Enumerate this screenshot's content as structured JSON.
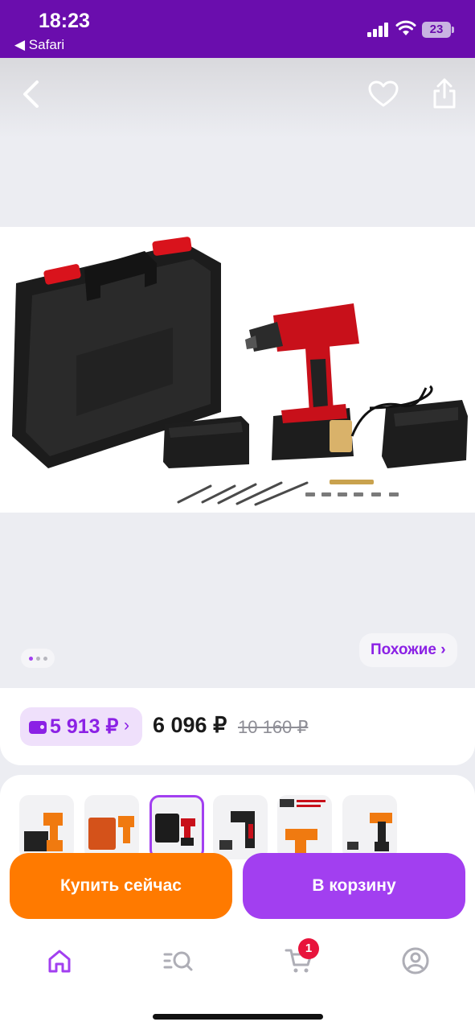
{
  "status_bar": {
    "time": "18:23",
    "back_app": "◀ Safari",
    "battery": "23"
  },
  "gallery": {
    "similar_label": "Похожие ›",
    "page_count": 3,
    "current_page": 1
  },
  "price": {
    "wallet_price": "5 913 ₽",
    "wallet_chevron": "›",
    "current": "6 096 ₽",
    "old": "10 160 ₽"
  },
  "variants": {
    "count": 6,
    "selected_index": 2
  },
  "actions": {
    "buy_now": "Купить сейчас",
    "add_to_cart": "В корзину"
  },
  "tabbar": {
    "cart_badge": "1"
  },
  "colors": {
    "brand_purple": "#a23ff0",
    "status_purple": "#6a0dad",
    "orange": "#ff7a00",
    "badge_red": "#e8143c"
  }
}
